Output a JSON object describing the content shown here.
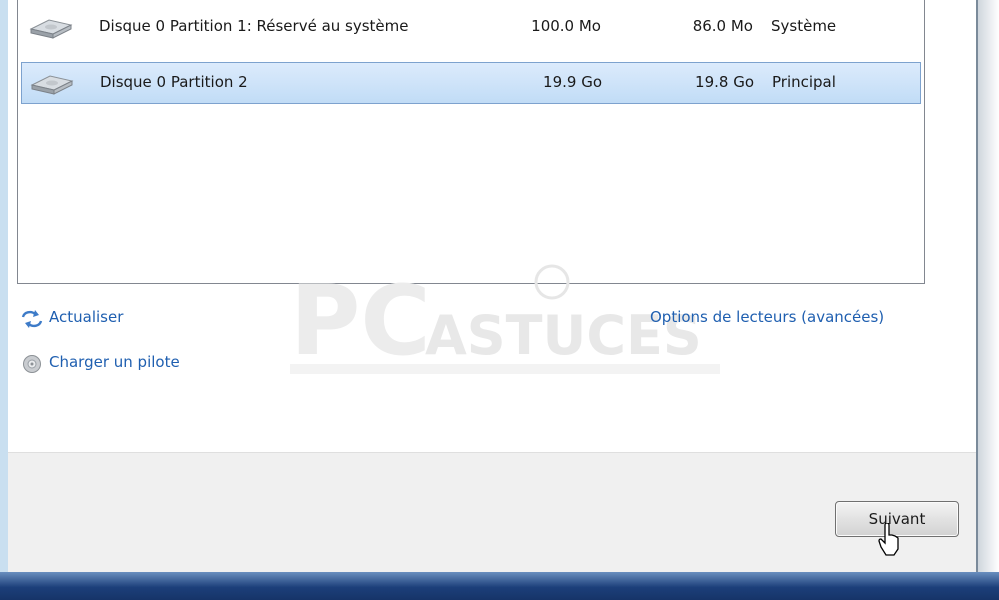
{
  "partitions": [
    {
      "name": "Disque 0 Partition 1: Réservé au système",
      "total_size": "100.0 Mo",
      "free_space": "86.0 Mo",
      "type": "Système",
      "selected": false
    },
    {
      "name": "Disque 0 Partition 2",
      "total_size": "19.9 Go",
      "free_space": "19.8 Go",
      "type": "Principal",
      "selected": true
    }
  ],
  "links": {
    "refresh": "Actualiser",
    "load_driver": "Charger un pilote",
    "drive_options": "Options de lecteurs (avancées)"
  },
  "buttons": {
    "next": "Suivant"
  },
  "watermark": {
    "brand_pc": "PC",
    "brand_astuces": "ASTUCES"
  },
  "icons": {
    "disk": "hard-disk-icon",
    "refresh": "refresh-icon",
    "load_driver": "driver-disc-icon",
    "cursor": "mouse-pointer-icon"
  },
  "colors": {
    "selection": "#c7def5",
    "selection_border": "#7da2ce",
    "link": "#1f5fb0",
    "taskbar": "#1c3f7a"
  }
}
